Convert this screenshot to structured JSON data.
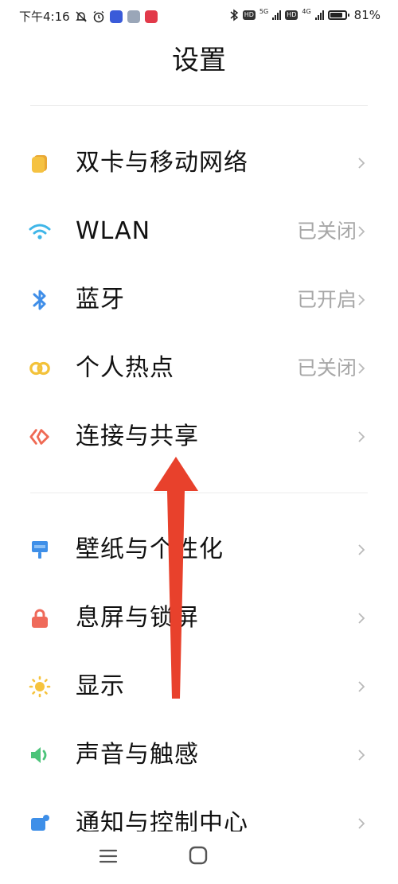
{
  "status_bar": {
    "time": "下午4:16",
    "network_1": "5G",
    "network_2": "4G",
    "hd_label": "HD",
    "battery": "81%",
    "battery_level": 0.81
  },
  "page": {
    "title": "设置"
  },
  "sections": [
    {
      "items": [
        {
          "label": "双卡与移动网络",
          "value": "",
          "icon": "sim-card-icon",
          "color": "#f5c242"
        },
        {
          "label": "WLAN",
          "value": "已关闭",
          "icon": "wifi-icon",
          "color": "#3fb6e8"
        },
        {
          "label": "蓝牙",
          "value": "已开启",
          "icon": "bluetooth-icon",
          "color": "#3f8ee8"
        },
        {
          "label": "个人热点",
          "value": "已关闭",
          "icon": "hotspot-icon",
          "color": "#f3c23a"
        },
        {
          "label": "连接与共享",
          "value": "",
          "icon": "share-icon",
          "color": "#ef6a54"
        }
      ]
    },
    {
      "items": [
        {
          "label": "壁纸与个性化",
          "value": "",
          "icon": "wallpaper-icon",
          "color": "#3e8fe8"
        },
        {
          "label": "息屏与锁屏",
          "value": "",
          "icon": "lock-icon",
          "color": "#ef6a5a"
        },
        {
          "label": "显示",
          "value": "",
          "icon": "sun-icon",
          "color": "#f6c33d"
        },
        {
          "label": "声音与触感",
          "value": "",
          "icon": "speaker-icon",
          "color": "#4cc47a"
        },
        {
          "label": "通知与控制中心",
          "value": "",
          "icon": "notification-icon",
          "color": "#3e8fe8"
        }
      ]
    }
  ],
  "annotation": {
    "color": "#e8412c"
  },
  "nav_bar": {
    "menu_icon": "menu-icon",
    "home_icon": "home-icon"
  }
}
